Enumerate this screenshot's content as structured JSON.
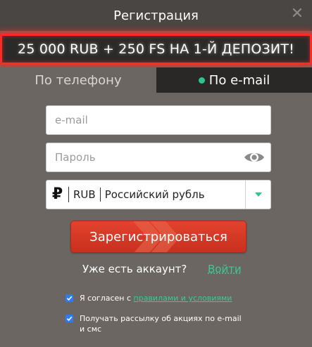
{
  "header": {
    "title": "Регистрация",
    "close_icon": "close-icon"
  },
  "promo": {
    "text": "25 000 RUB + 250 FS НА 1-Й ДЕПОЗИТ!"
  },
  "tabs": [
    {
      "label": "По телефону",
      "active": false
    },
    {
      "label": "По e-mail",
      "active": true
    }
  ],
  "form": {
    "email_placeholder": "e-mail",
    "password_placeholder": "Пароль",
    "currency": {
      "symbol": "₽",
      "code": "RUB",
      "name": "Российский рубль"
    },
    "register_label": "Зарегистрироваться",
    "have_account_text": "Уже есть аккаунт?",
    "login_label": "Войти",
    "terms_prefix": "Я согласен с ",
    "terms_link": "правилами и условиями",
    "newsletter_text": "Получать рассылку об акциях по e-mail и смс",
    "terms_checked": true,
    "newsletter_checked": true
  },
  "colors": {
    "accent_green": "#2ec48e",
    "button_red": "#d63a27",
    "promo_border": "#ff2a24",
    "checkbox_blue": "#2d7cf6"
  }
}
